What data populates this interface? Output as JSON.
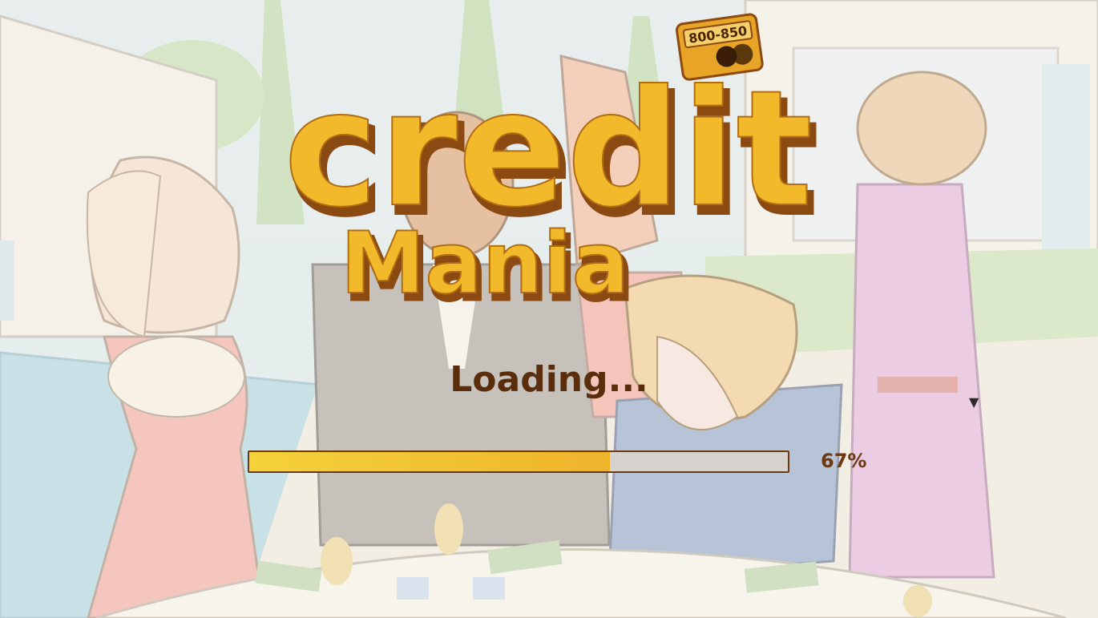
{
  "logo": {
    "credit_word": "credit",
    "mania_word": "Mania",
    "badge_text": "800-850"
  },
  "loading": {
    "label": "Loading...",
    "progress_percent": 67,
    "progress_label": "67%"
  },
  "icons": {
    "dropdown": "caret-down-icon"
  },
  "colors": {
    "bar_fill_start": "#f4d23a",
    "bar_fill_end": "#efb42a",
    "bar_track": "#d6d3cf",
    "bar_border": "#6b3a12",
    "text_brown": "#5a2d0c",
    "logo_yellow": "#f2b92b",
    "logo_shadow": "#8a4a12"
  }
}
